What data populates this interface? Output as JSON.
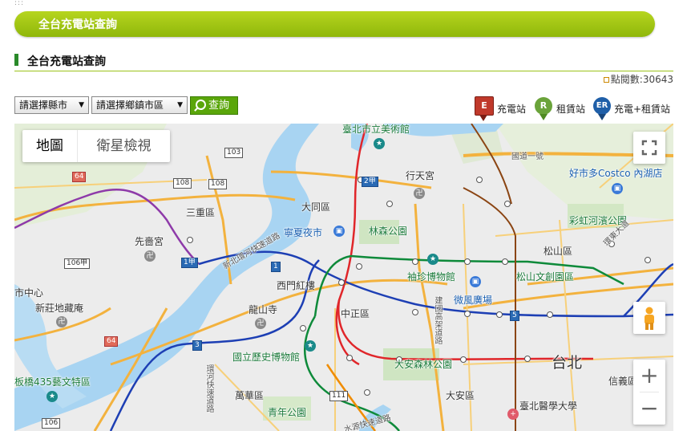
{
  "header": {
    "banner_title": "全台充電站查詢",
    "section_title": "全台充電站查詢",
    "view_count": "點閱數:30643"
  },
  "filters": {
    "county_select": "請選擇縣市",
    "district_select": "請選擇鄉鎮市區",
    "query_button": "查詢"
  },
  "legend": [
    {
      "icon": "E",
      "label": "充電站",
      "color": "#c0392b"
    },
    {
      "icon": "R",
      "label": "租賃站",
      "color": "#6aa33a"
    },
    {
      "icon": "ER",
      "label": "充電+租賃站",
      "color": "#1f5fa8"
    }
  ],
  "map": {
    "type_map": "地圖",
    "type_satellite": "衛星檢視",
    "zoom_in": "+",
    "zoom_out": "−",
    "labels": {
      "museum_fine_art": "臺北市立美術館",
      "xingtian": "行天宮",
      "costco": "好市多Costco 內湖店",
      "sanchong": "三重區",
      "datong": "大同區",
      "ningxia": "寧夏夜市",
      "linsen": "林森公園",
      "rainbow_park": "彩虹河濱公園",
      "songshan": "松山區",
      "xianse": "先嗇宮",
      "xinzhuang_center": "市中心",
      "xinzhuang_museum": "新莊地藏庵",
      "ximen": "西門紅樓",
      "longshan": "龍山寺",
      "zhongzheng": "中正區",
      "postal_museum": "袖珍博物館",
      "songshan_park": "松山文創園區",
      "weixiu": "微風廣場",
      "history_museum": "國立歷史博物館",
      "daan_park": "大安森林公園",
      "taipei": "台北",
      "xinyi": "信義區",
      "wanhua": "萬華區",
      "youth_park": "青年公園",
      "daan": "大安區",
      "tmu": "臺北醫學大學",
      "banqiao": "板橋435藝文特區",
      "national_hwy": "國道一號",
      "xinbei_expwy": "新北環河快速道路",
      "jianguo": "建國高架道路",
      "shuiyuan": "水源快速道路",
      "huanhe": "環東大道",
      "expwy_w": "環河快速道路",
      "ring_blvd": "環河快速道路"
    },
    "shields": [
      "103",
      "108",
      "64",
      "106甲",
      "1甲",
      "1",
      "2甲",
      "64",
      "3",
      "5",
      "111",
      "106",
      "108"
    ]
  }
}
